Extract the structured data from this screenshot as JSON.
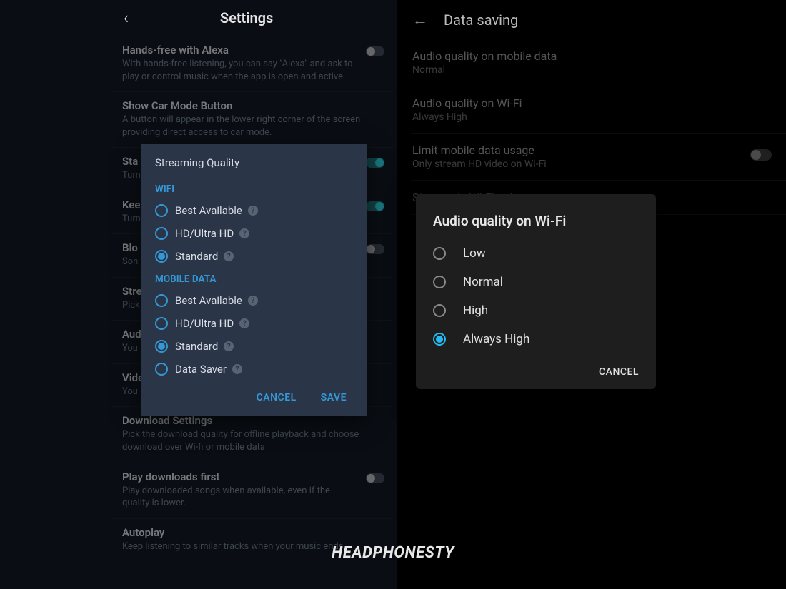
{
  "watermark": "HEADPHONESTY",
  "left": {
    "header_title": "Settings",
    "rows": [
      {
        "title": "Hands-free with Alexa",
        "desc": "With hands-free listening, you can say \"Alexa\" and ask to play or control music when the app is open and active.",
        "toggle": "off"
      },
      {
        "title": "Show Car Mode Button",
        "desc": "A button will appear in the lower right corner of the screen providing direct access to car mode.",
        "toggle": null
      },
      {
        "title": "Sta",
        "desc": "Turn Mode",
        "toggle": "on"
      },
      {
        "title": "Kee",
        "desc": "Turn screen",
        "toggle": "on"
      },
      {
        "title": "Blo",
        "desc": "Son",
        "toggle": "off"
      },
      {
        "title": "Stre",
        "desc": "Pick",
        "toggle": null
      },
      {
        "title": "Aud",
        "desc": "You",
        "toggle": null
      },
      {
        "title": "Vide",
        "desc": "You",
        "toggle": null
      },
      {
        "title": "Download Settings",
        "desc": "Pick the download quality for offline playback and choose download over Wi-fi or mobile data",
        "toggle": null
      },
      {
        "title": "Play downloads first",
        "desc": "Play downloaded songs when available, even if the quality is lower.",
        "toggle": "off"
      },
      {
        "title": "Autoplay",
        "desc": "Keep listening to similar tracks when your music ends.",
        "toggle": null
      }
    ],
    "dialog": {
      "title": "Streaming Quality",
      "section_wifi": "WIFI",
      "section_data": "MOBILE DATA",
      "wifi_options": [
        {
          "label": "Best Available",
          "selected": false,
          "help": true
        },
        {
          "label": "HD/Ultra HD",
          "selected": false,
          "help": true
        },
        {
          "label": "Standard",
          "selected": true,
          "help": true
        }
      ],
      "data_options": [
        {
          "label": "Best Available",
          "selected": false,
          "help": true
        },
        {
          "label": "HD/Ultra HD",
          "selected": false,
          "help": true
        },
        {
          "label": "Standard",
          "selected": true,
          "help": true
        },
        {
          "label": "Data Saver",
          "selected": false,
          "help": true
        }
      ],
      "cancel": "CANCEL",
      "save": "SAVE"
    }
  },
  "right": {
    "header_title": "Data saving",
    "rows": [
      {
        "title": "Audio quality on mobile data",
        "sub": "Normal"
      },
      {
        "title": "Audio quality on Wi-Fi",
        "sub": "Always High"
      },
      {
        "title": "Limit mobile data usage",
        "sub": "Only stream HD video on Wi-Fi",
        "toggle": "off"
      },
      {
        "title_cut": "Stream via Wi-Fi only"
      }
    ],
    "dialog": {
      "title": "Audio quality on Wi-Fi",
      "options": [
        {
          "label": "Low",
          "selected": false
        },
        {
          "label": "Normal",
          "selected": false
        },
        {
          "label": "High",
          "selected": false
        },
        {
          "label": "Always High",
          "selected": true
        }
      ],
      "cancel": "CANCEL"
    }
  }
}
